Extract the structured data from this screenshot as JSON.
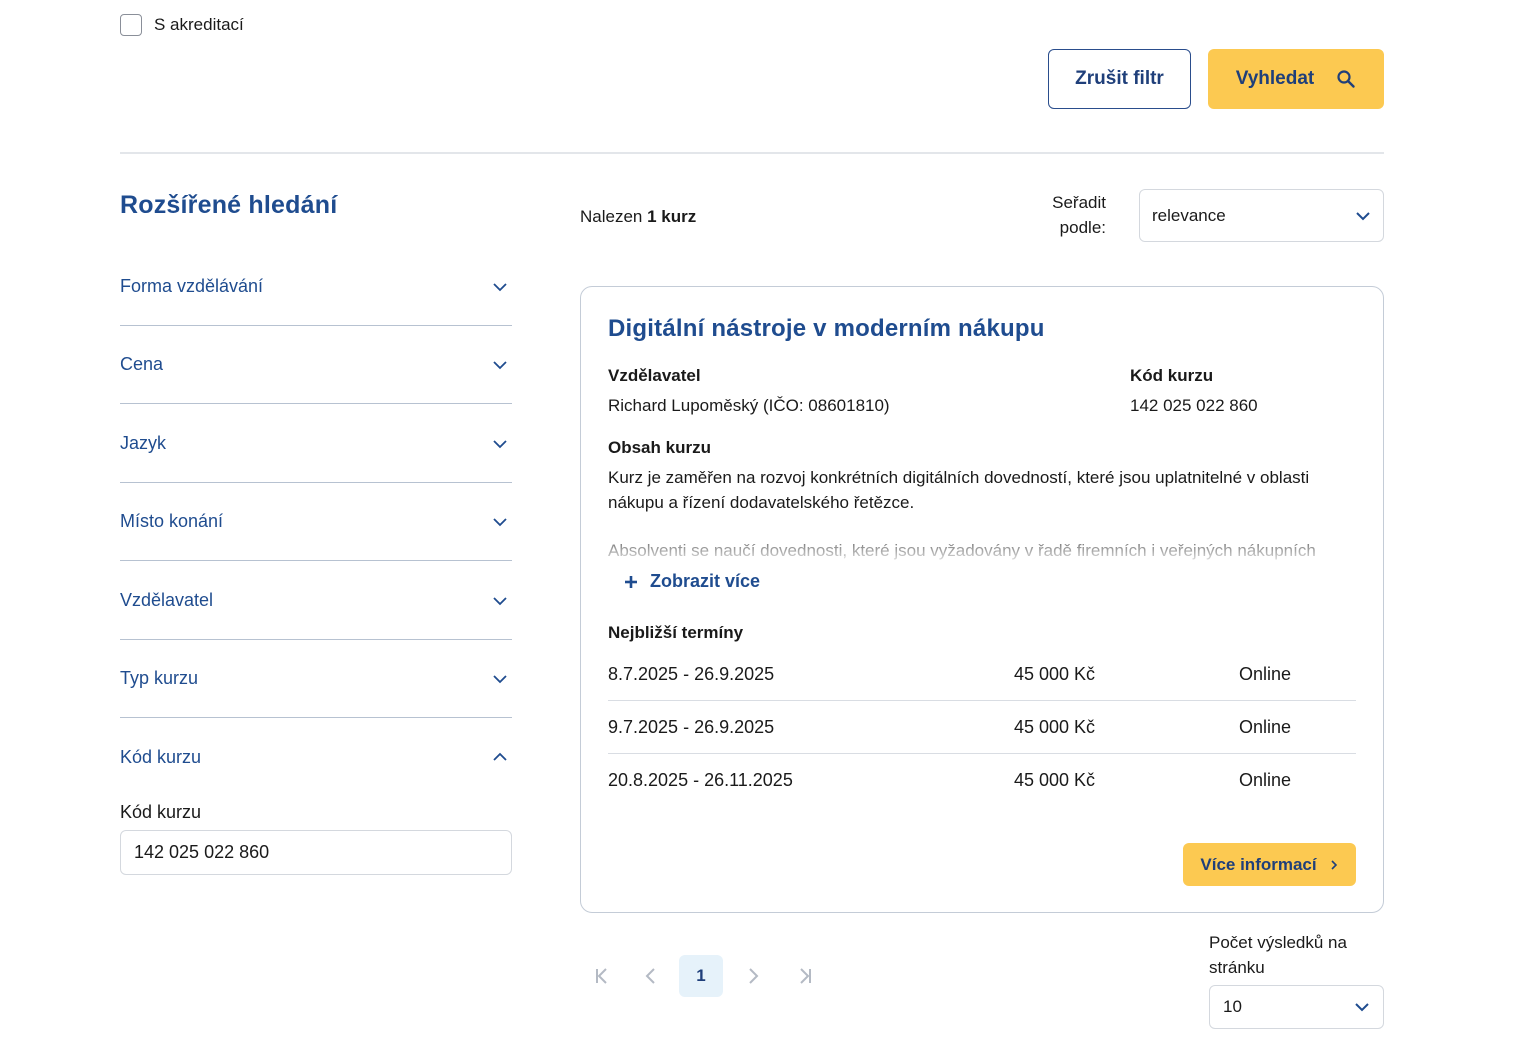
{
  "filters": {
    "accreditation_label": "S akreditací",
    "reset_label": "Zrušit filtr",
    "search_label": "Vyhledat"
  },
  "sidebar": {
    "title": "Rozšířené hledání",
    "items": [
      {
        "label": "Forma vzdělávání"
      },
      {
        "label": "Cena"
      },
      {
        "label": "Jazyk"
      },
      {
        "label": "Místo konání"
      },
      {
        "label": "Vzdělavatel"
      },
      {
        "label": "Typ kurzu"
      },
      {
        "label": "Kód kurzu"
      }
    ],
    "code_field_label": "Kód kurzu",
    "code_field_value": "142 025 022 860"
  },
  "results": {
    "found_prefix": "Nalezen",
    "found_count": "1 kurz",
    "sort_label_line1": "Seřadit",
    "sort_label_line2": "podle:",
    "sort_value": "relevance"
  },
  "course": {
    "title": "Digitální nástroje v moderním nákupu",
    "provider_label": "Vzdělavatel",
    "provider_value": "Richard Lupoměský (IČO: 08601810)",
    "code_label": "Kód kurzu",
    "code_value": "142 025 022 860",
    "content_label": "Obsah kurzu",
    "content_text": "Kurz je zaměřen na rozvoj konkrétních digitálních dovedností, které jsou uplatnitelné v oblasti nákupu a řízení dodavatelského řetězce.",
    "content_text_more": "Absolventi se naučí dovednosti, které jsou vyžadovány v řadě firemních i veřejných nákupních",
    "show_more_label": "Zobrazit více",
    "terms_label": "Nejbližší termíny",
    "terms": [
      {
        "date": "8.7.2025 - 26.9.2025",
        "price": "45 000 Kč",
        "place": "Online"
      },
      {
        "date": "9.7.2025 - 26.9.2025",
        "price": "45 000 Kč",
        "place": "Online"
      },
      {
        "date": "20.8.2025 - 26.11.2025",
        "price": "45 000 Kč",
        "place": "Online"
      }
    ],
    "more_info_label": "Více informací"
  },
  "pagination": {
    "current_page": "1",
    "per_page_label": "Počet výsledků na stránku",
    "per_page_value": "10"
  },
  "colors": {
    "brand_blue": "#1f4c8f",
    "accent_yellow": "#fcc951",
    "active_page_bg": "#e6f2fa"
  }
}
